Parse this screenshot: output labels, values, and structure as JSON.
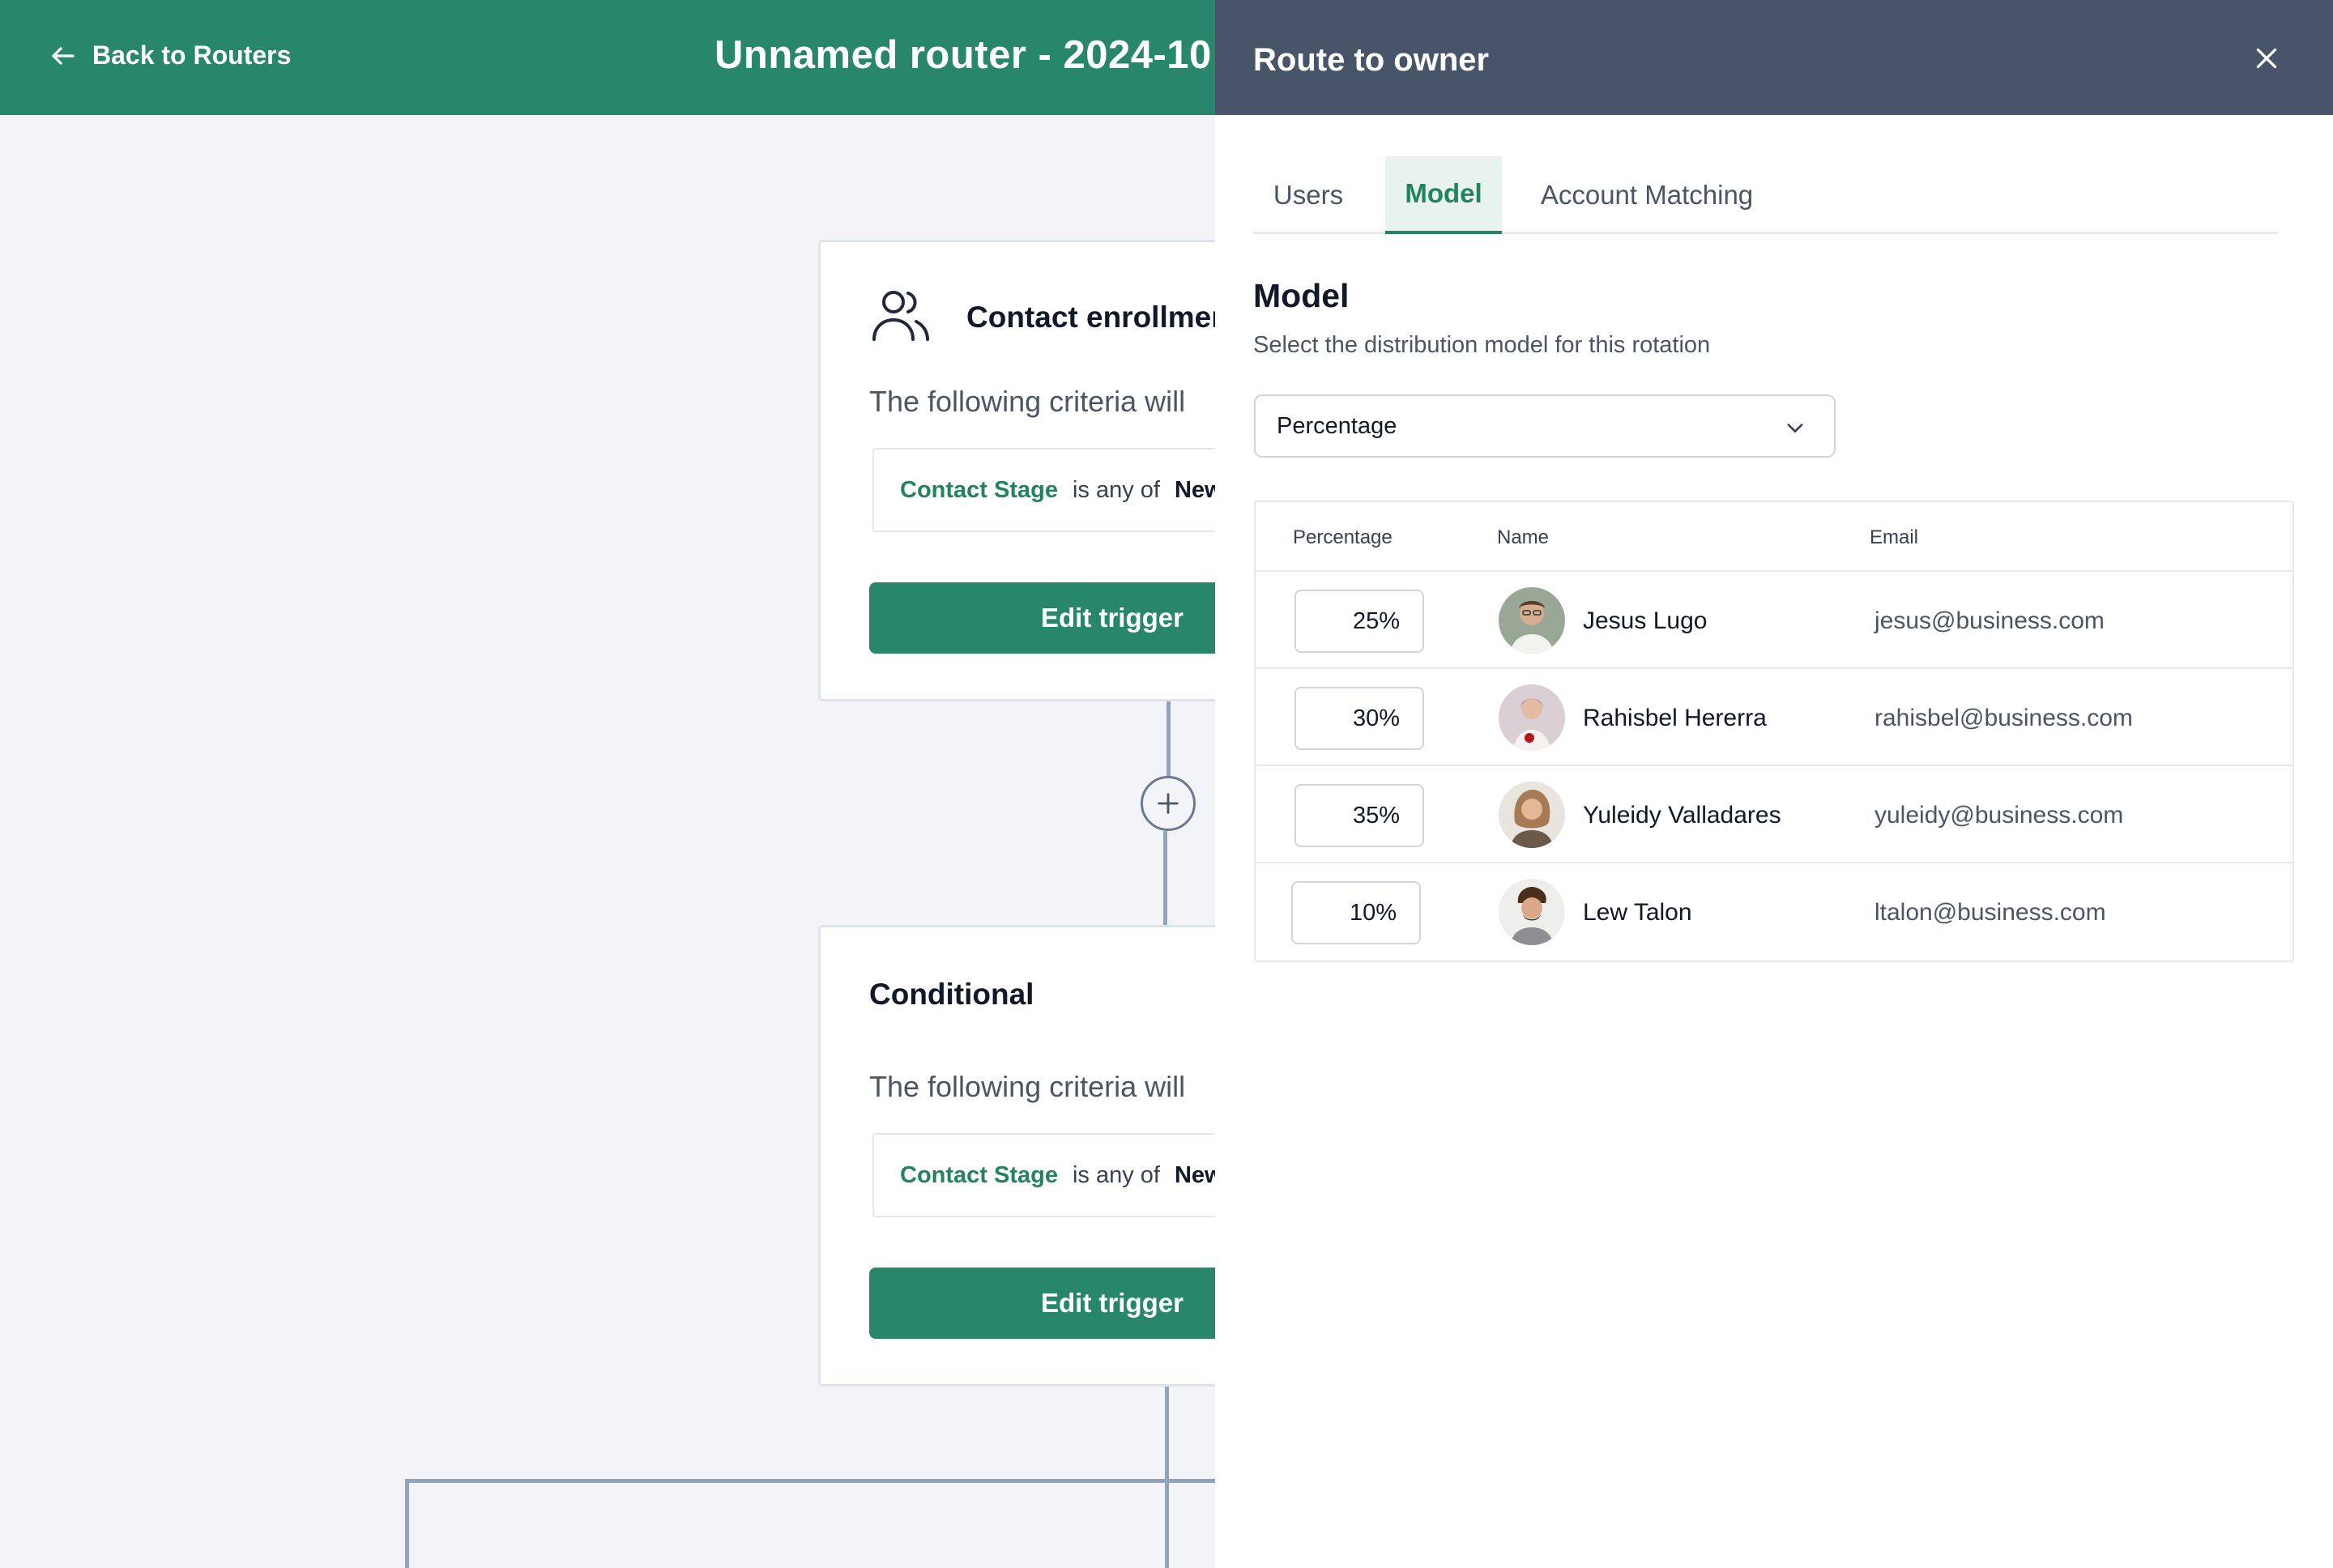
{
  "header": {
    "back_label": "Back to Routers",
    "router_title": "Unnamed router - 2024-10"
  },
  "canvas": {
    "trigger_card": {
      "title": "Contact enrollment",
      "subtitle": "The following criteria will",
      "criteria_field": "Contact Stage",
      "criteria_op": "is any of",
      "criteria_value": "New",
      "edit_label": "Edit trigger"
    },
    "conditional_card": {
      "title": "Conditional",
      "subtitle": "The following criteria will",
      "criteria_field": "Contact Stage",
      "criteria_op": "is any of",
      "criteria_value": "New",
      "edit_label": "Edit trigger"
    }
  },
  "drawer": {
    "title": "Route to owner",
    "tabs": [
      {
        "label": "Users",
        "active": false
      },
      {
        "label": "Model",
        "active": true
      },
      {
        "label": "Account Matching",
        "active": false
      }
    ],
    "section_title": "Model",
    "section_desc": "Select the distribution model for this rotation",
    "model_select": {
      "value": "Percentage"
    },
    "table": {
      "headers": {
        "percentage": "Percentage",
        "name": "Name",
        "email": "Email"
      },
      "rows": [
        {
          "percentage": "25%",
          "name": "Jesus Lugo",
          "email": "jesus@business.com"
        },
        {
          "percentage": "30%",
          "name": "Rahisbel Hererra",
          "email": "rahisbel@business.com"
        },
        {
          "percentage": "35%",
          "name": "Yuleidy Valladares",
          "email": "yuleidy@business.com"
        },
        {
          "percentage": "10%",
          "name": "Lew Talon",
          "email": "ltalon@business.com"
        }
      ]
    }
  },
  "colors": {
    "brand_green": "#28876b",
    "drawer_header": "#485568",
    "canvas_bg": "#f3f4f7"
  }
}
